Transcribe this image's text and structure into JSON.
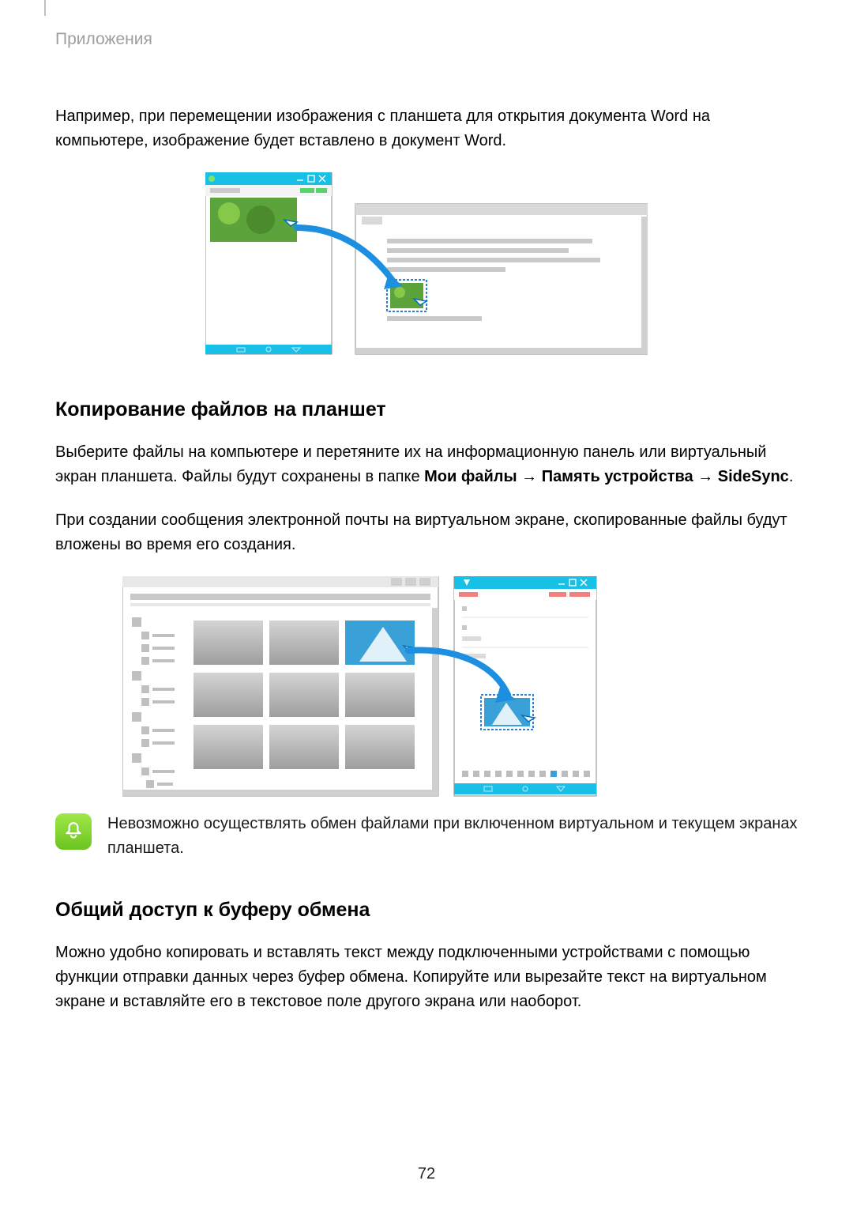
{
  "header": "Приложения",
  "para1": "Например, при перемещении изображения с планшета для открытия документа Word на компьютере, изображение будет вставлено в документ Word.",
  "section1": {
    "title": "Копирование файлов на планшет",
    "para_a_prefix": "Выберите файлы на компьютере и перетяните их на информационную панель или виртуальный экран планшета. Файлы будут сохранены в папке ",
    "bold1": "Мои файлы",
    "arrow": " → ",
    "bold2": "Память устройства",
    "bold3": "SideSync",
    "period": ".",
    "para_b": "При создании сообщения электронной почты на виртуальном экране, скопированные файлы будут вложены во время его создания."
  },
  "note": "Невозможно осуществлять обмен файлами при включенном виртуальном и текущем экранах планшета.",
  "section2": {
    "title": "Общий доступ к буферу обмена",
    "para": "Можно удобно копировать и вставлять текст между подключенными устройствами с помощью функции отправки данных через буфер обмена. Копируйте или вырезайте текст на виртуальном экране и вставляйте его в текстовое поле другого экрана или наоборот."
  },
  "page_number": "72"
}
